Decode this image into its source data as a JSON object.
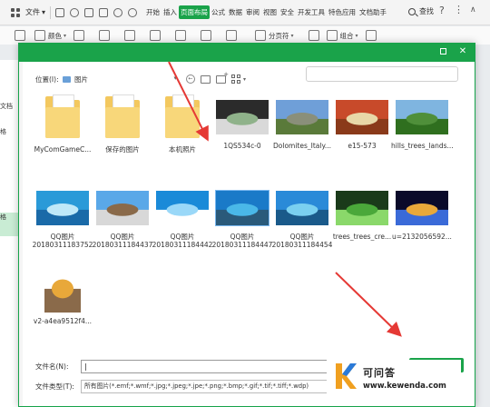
{
  "app": {
    "menu_file_label": "文件",
    "menu_tabs": [
      "开始",
      "插入",
      "页面布局",
      "公式",
      "数据",
      "审阅",
      "视图",
      "安全",
      "开发工具",
      "特色应用",
      "文档助手"
    ],
    "active_tab": "页面布局",
    "search_label": "查找",
    "accent_color": "#1aa34a"
  },
  "toolbar": {
    "color_label": "颜色",
    "page_break_label": "分页符",
    "combine_label": "组合"
  },
  "background_sidebar": {
    "labels": [
      "文档",
      "格",
      "格"
    ]
  },
  "dialog": {
    "location_label": "位置(I):",
    "location_value": "图片",
    "files": [
      {
        "name": "MyComGameC...",
        "kind": "folder"
      },
      {
        "name": "保存的图片",
        "kind": "folder"
      },
      {
        "name": "本机照片",
        "kind": "folder"
      },
      {
        "name": "1QS534c-0",
        "kind": "image",
        "palette": [
          "#2b2b2b",
          "#8fb28a",
          "#d9d9d9"
        ]
      },
      {
        "name": "Dolomites_Italy...",
        "kind": "image",
        "palette": [
          "#6f9fd8",
          "#8a8f7a",
          "#5a7a3a"
        ]
      },
      {
        "name": "e15-573",
        "kind": "image",
        "palette": [
          "#c84a2a",
          "#e8d8a8",
          "#8a3a1a"
        ]
      },
      {
        "name": "hills_trees_lands...",
        "kind": "image",
        "palette": [
          "#7fb5e0",
          "#4f8f3a",
          "#2f6f1f"
        ]
      },
      {
        "name": "QQ图片",
        "name2": "20180311183752",
        "kind": "image",
        "palette": [
          "#2a9ad8",
          "#bfe8f8",
          "#1a6aa8"
        ]
      },
      {
        "name": "QQ图片",
        "name2": "20180311184437",
        "kind": "image",
        "palette": [
          "#5aa8e8",
          "#8a6a4a",
          "#d8d8d8"
        ]
      },
      {
        "name": "QQ图片",
        "name2": "20180311184442",
        "kind": "image",
        "palette": [
          "#1a8ad8",
          "#9ad8f8",
          "#ffffff"
        ]
      },
      {
        "name": "QQ图片",
        "name2": "20180311184447",
        "kind": "image",
        "palette": [
          "#1a7ac8",
          "#4ab8e8",
          "#2a5a7a"
        ]
      },
      {
        "name": "QQ图片",
        "name2": "20180311184454",
        "kind": "image",
        "palette": [
          "#2a8ad8",
          "#7ad0f0",
          "#1a5a8a"
        ]
      },
      {
        "name": "trees_trees_cre...",
        "kind": "image",
        "palette": [
          "#1a3a1a",
          "#4aa83a",
          "#8ad86a"
        ]
      },
      {
        "name": "u=2132056592...",
        "kind": "image",
        "palette": [
          "#0a0a2a",
          "#e8a83a",
          "#3a6ad8"
        ]
      },
      {
        "name": "v2-a4ea9512f4...",
        "kind": "image",
        "palette": [
          "#ffffff",
          "#e8a83a",
          "#8a6a4a"
        ]
      }
    ],
    "filename_label": "文件名(N):",
    "filename_value": "",
    "filetype_label": "文件类型(T):",
    "filetype_value": "所有图片(*.emf;*.wmf;*.jpg;*.jpeg;*.jpe;*.png;*.bmp;*.gif;*.tif;*.tiff;*.wdp)"
  },
  "watermark": {
    "title": "可问答",
    "url": "www.kewenda.com"
  }
}
